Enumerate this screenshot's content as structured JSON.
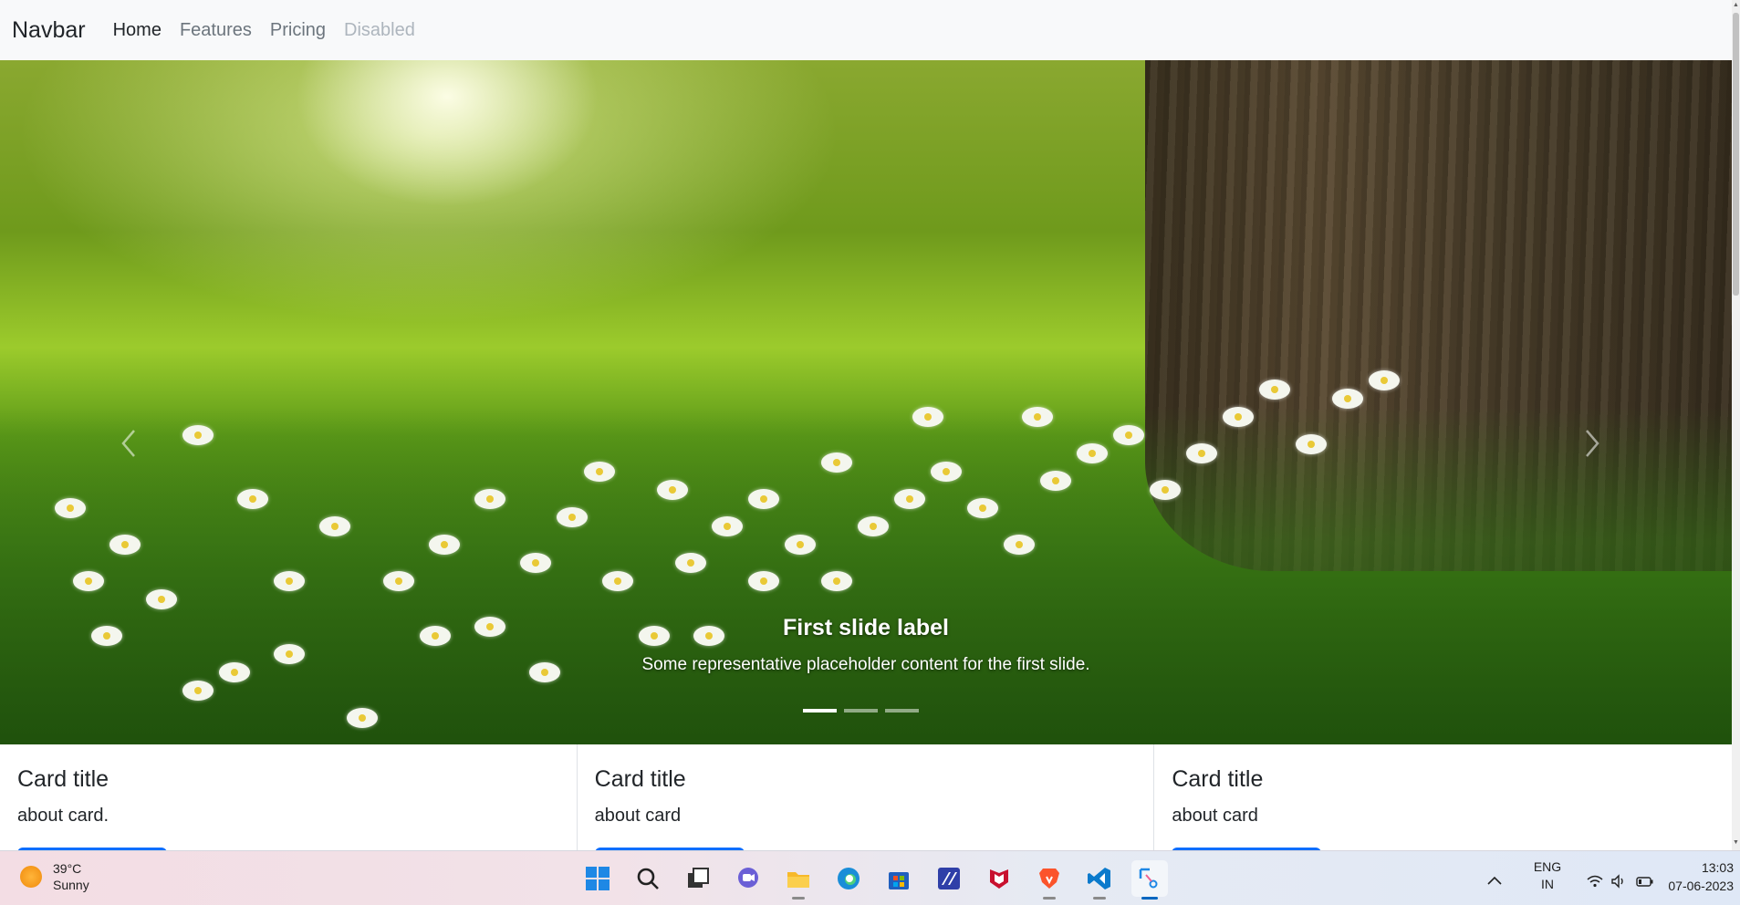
{
  "navbar": {
    "brand": "Navbar",
    "links": [
      {
        "label": "Home",
        "state": "active"
      },
      {
        "label": "Features",
        "state": "normal"
      },
      {
        "label": "Pricing",
        "state": "normal"
      },
      {
        "label": "Disabled",
        "state": "disabled"
      }
    ]
  },
  "carousel": {
    "prev_icon": "chevron-left-icon",
    "next_icon": "chevron-right-icon",
    "caption_title": "First slide label",
    "caption_text": "Some representative placeholder content for the first slide.",
    "indicators_count": 3,
    "active_indicator": 1
  },
  "cards": [
    {
      "title": "Card title",
      "text": "about card."
    },
    {
      "title": "Card title",
      "text": "about card"
    },
    {
      "title": "Card title",
      "text": "about card"
    }
  ],
  "taskbar": {
    "weather_temp": "39°C",
    "weather_desc": "Sunny",
    "apps": [
      "start-icon",
      "search-icon",
      "task-view-icon",
      "chat-icon",
      "file-explorer-icon",
      "edge-icon",
      "store-icon",
      "editor-icon",
      "mcafee-icon",
      "brave-icon",
      "vscode-icon",
      "snipping-tool-icon"
    ],
    "lang_top": "ENG",
    "lang_bottom": "IN",
    "time": "13:03",
    "date": "07-06-2023"
  },
  "colors": {
    "primary": "#0d6efd",
    "navbar_bg": "#f8f9fa"
  }
}
